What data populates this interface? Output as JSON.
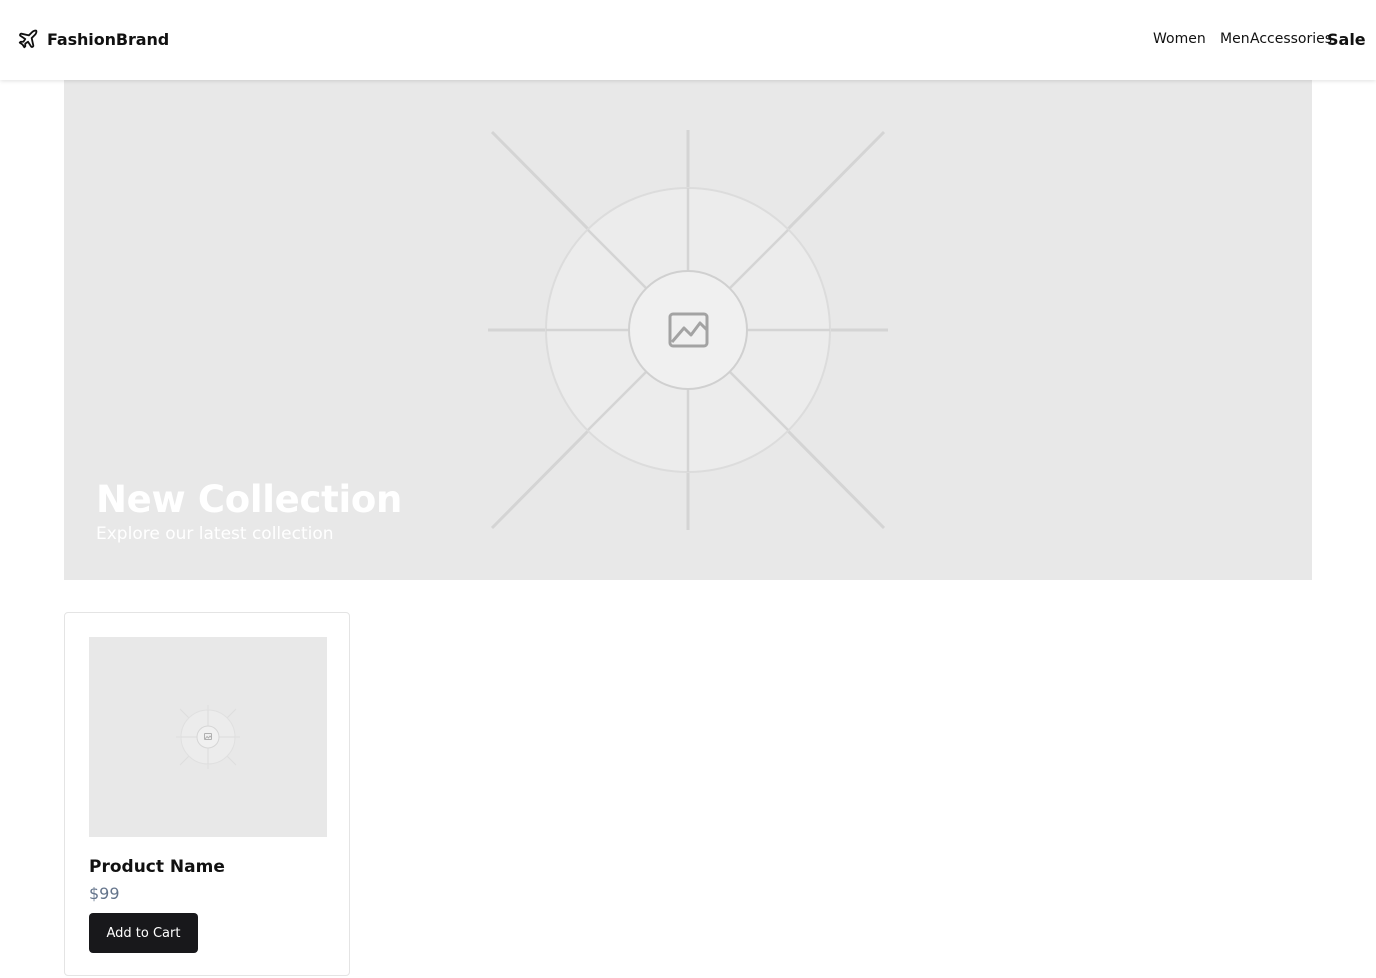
{
  "header": {
    "brand_name": "FashionBrand",
    "brand_icon": "plane-icon",
    "nav": [
      "Women",
      "Men",
      "Accessories",
      "Sale"
    ]
  },
  "hero": {
    "image_icon": "image-placeholder-icon",
    "title": "New Collection",
    "subtitle": "Explore our latest collection"
  },
  "products": [
    {
      "image_icon": "image-placeholder-icon",
      "name": "Product Name",
      "price": "$99",
      "button_label": "Add to Cart"
    }
  ],
  "colors": {
    "primary_button": "#18181b",
    "placeholder_bg": "#e8e8e8",
    "price": "#64748b"
  }
}
